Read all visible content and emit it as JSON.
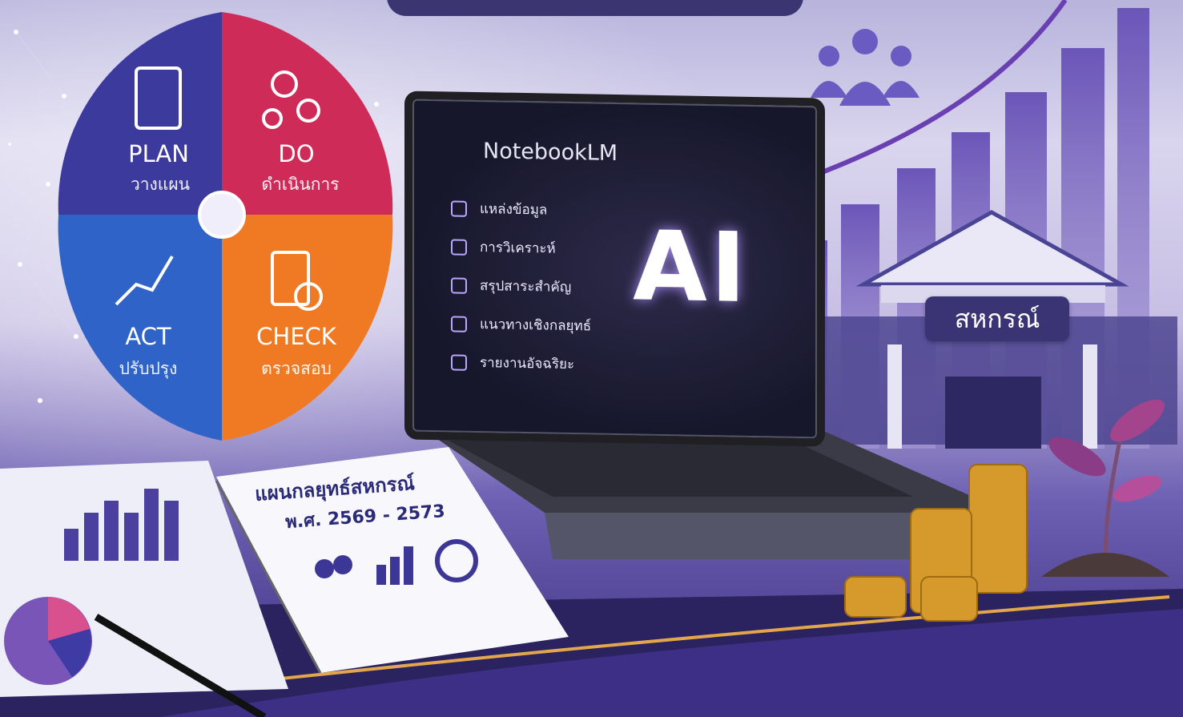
{
  "pdca": {
    "plan": {
      "en": "PLAN",
      "th": "วางแผน"
    },
    "do": {
      "en": "DO",
      "th": "ดำเนินการ"
    },
    "act": {
      "en": "ACT",
      "th": "ปรับปรุง"
    },
    "check": {
      "en": "CHECK",
      "th": "ตรวจสอบ"
    }
  },
  "laptop": {
    "app_name": "NotebookLM",
    "menu": [
      "แหล่งข้อมูล",
      "การวิเคราะห์",
      "สรุปสาระสำคัญ",
      "แนวทางเชิงกลยุทธ์",
      "รายงานอัจฉริยะ"
    ],
    "center_text": "AI"
  },
  "building_sign": "สหกรณ์",
  "book": {
    "title": "แผนกลยุทธ์สหกรณ์",
    "years": "พ.ศ. 2569 - 2573"
  },
  "colors": {
    "plan": "#3b3b9e",
    "do": "#d02a57",
    "act": "#2e62c4",
    "check": "#f07a24",
    "accent": "#3b3572",
    "gold": "#d79b2e"
  }
}
